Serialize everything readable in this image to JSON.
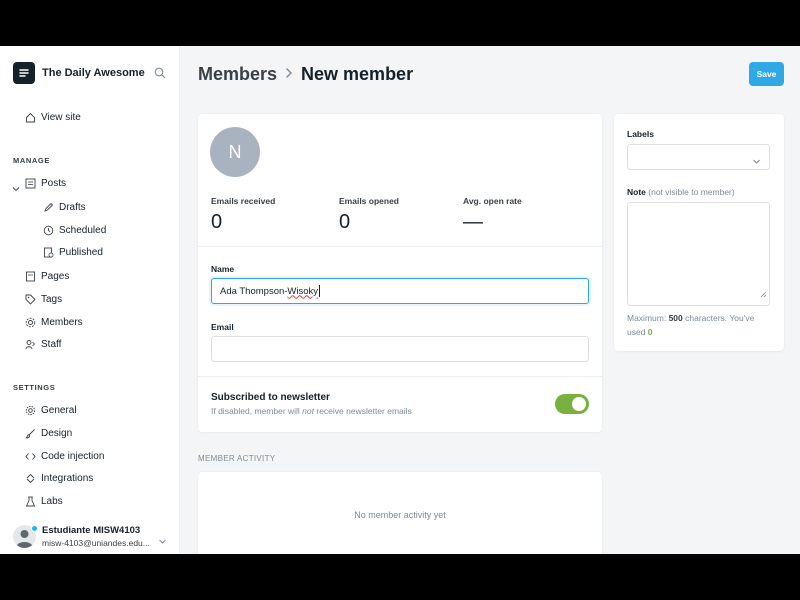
{
  "brand": {
    "name": "The Daily Awesome"
  },
  "sidebar": {
    "view_site": "View site",
    "manage_title": "MANAGE",
    "settings_title": "SETTINGS",
    "manage_items": [
      {
        "label": "Posts",
        "icon": "posts-icon"
      },
      {
        "label": "Drafts",
        "icon": "pencil-icon"
      },
      {
        "label": "Scheduled",
        "icon": "clock-icon"
      },
      {
        "label": "Published",
        "icon": "published-icon"
      },
      {
        "label": "Pages",
        "icon": "pages-icon"
      },
      {
        "label": "Tags",
        "icon": "tag-icon"
      },
      {
        "label": "Members",
        "icon": "members-icon"
      },
      {
        "label": "Staff",
        "icon": "staff-icon"
      }
    ],
    "settings_items": [
      {
        "label": "General",
        "icon": "gear-icon"
      },
      {
        "label": "Design",
        "icon": "brush-icon"
      },
      {
        "label": "Code injection",
        "icon": "code-icon"
      },
      {
        "label": "Integrations",
        "icon": "integrations-icon"
      },
      {
        "label": "Labs",
        "icon": "flask-icon"
      }
    ],
    "user": {
      "name": "Estudiante MISW4103",
      "email": "misw-4103@uniandes.edu..."
    }
  },
  "header": {
    "breadcrumb_parent": "Members",
    "breadcrumb_current": "New member",
    "save_label": "Save"
  },
  "member": {
    "avatar_initial": "N",
    "stats": [
      {
        "label": "Emails received",
        "value": "0"
      },
      {
        "label": "Emails opened",
        "value": "0"
      },
      {
        "label": "Avg. open rate",
        "value": "—"
      }
    ],
    "name_label": "Name",
    "name_value_first": "Ada Thompson-",
    "name_value_typo": "Wisoky",
    "email_label": "Email",
    "email_value": "",
    "newsletter_title": "Subscribed to newsletter",
    "newsletter_desc_pre": "If disabled, member will ",
    "newsletter_desc_em": "not",
    "newsletter_desc_post": " receive newsletter emails",
    "subscribed": true
  },
  "activity": {
    "title": "MEMBER ACTIVITY",
    "empty": "No member activity yet"
  },
  "side": {
    "labels_label": "Labels",
    "note_label": "Note",
    "note_hint_label": "(not visible to member)",
    "note_hint_pre": "Maximum: ",
    "note_max": "500",
    "note_hint_mid": " characters. You've used ",
    "note_used": "0"
  },
  "colors": {
    "accent": "#30a8e6",
    "toggle_on": "#7ab03f",
    "sidebar_text": "#15212a"
  }
}
